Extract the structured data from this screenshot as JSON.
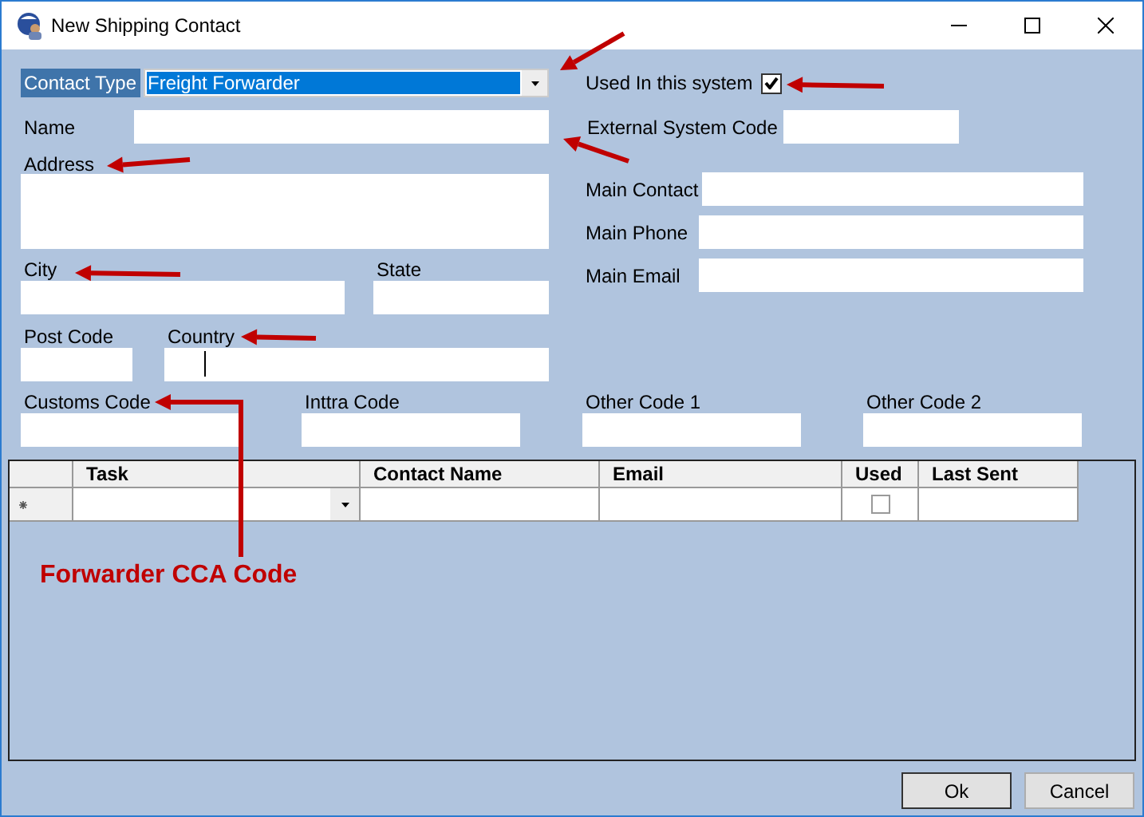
{
  "window": {
    "title": "New Shipping Contact"
  },
  "contact_type": {
    "label": "Contact Type",
    "value": "Freight Forwarder"
  },
  "used_in_system": {
    "label": "Used In this system",
    "checked": true
  },
  "name": {
    "label": "Name"
  },
  "external_system_code": {
    "label": "External System Code"
  },
  "address": {
    "label": "Address"
  },
  "city": {
    "label": "City"
  },
  "state": {
    "label": "State"
  },
  "post_code": {
    "label": "Post Code"
  },
  "country": {
    "label": "Country",
    "focused": true
  },
  "main_contact": {
    "label": "Main Contact"
  },
  "main_phone": {
    "label": "Main Phone"
  },
  "main_email": {
    "label": "Main Email"
  },
  "codes": [
    {
      "label": "Customs Code"
    },
    {
      "label": "Inttra Code"
    },
    {
      "label": "Other Code 1"
    },
    {
      "label": "Other Code 2"
    }
  ],
  "table": {
    "columns": [
      "Task",
      "Contact Name",
      "Email",
      "Used",
      "Last Sent"
    ],
    "new_row": {
      "used": {
        "checked": false
      }
    }
  },
  "annotation": "Forwarder CCA Code",
  "buttons": [
    "Ok",
    "Cancel"
  ]
}
